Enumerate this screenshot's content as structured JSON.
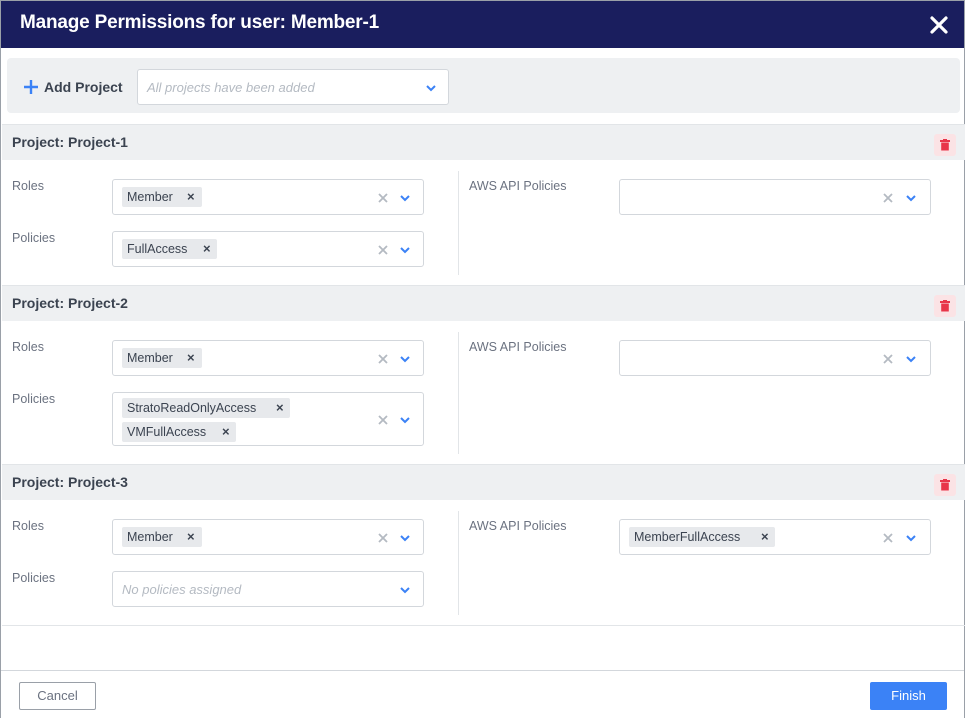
{
  "dialog": {
    "title": "Manage Permissions for user: Member-1"
  },
  "add_bar": {
    "button_label": "Add Project",
    "select_placeholder": "All projects have been added"
  },
  "labels": {
    "roles": "Roles",
    "policies": "Policies",
    "aws_api_policies": "AWS API Policies"
  },
  "projects": [
    {
      "title": "Project: Project-1",
      "roles": [
        "Member"
      ],
      "policies": [
        "FullAccess"
      ],
      "aws_api_policies": []
    },
    {
      "title": "Project: Project-2",
      "roles": [
        "Member"
      ],
      "policies": [
        "StratoReadOnlyAccess",
        "VMFullAccess"
      ],
      "aws_api_policies": []
    },
    {
      "title": "Project: Project-3",
      "roles": [
        "Member"
      ],
      "policies": [],
      "policies_placeholder": "No policies assigned",
      "aws_api_policies": [
        "MemberFullAccess"
      ]
    }
  ],
  "footer": {
    "cancel_label": "Cancel",
    "finish_label": "Finish"
  },
  "colors": {
    "titlebar": "#1a1e5e",
    "accent": "#3b82f6",
    "danger": "#e8364a"
  }
}
